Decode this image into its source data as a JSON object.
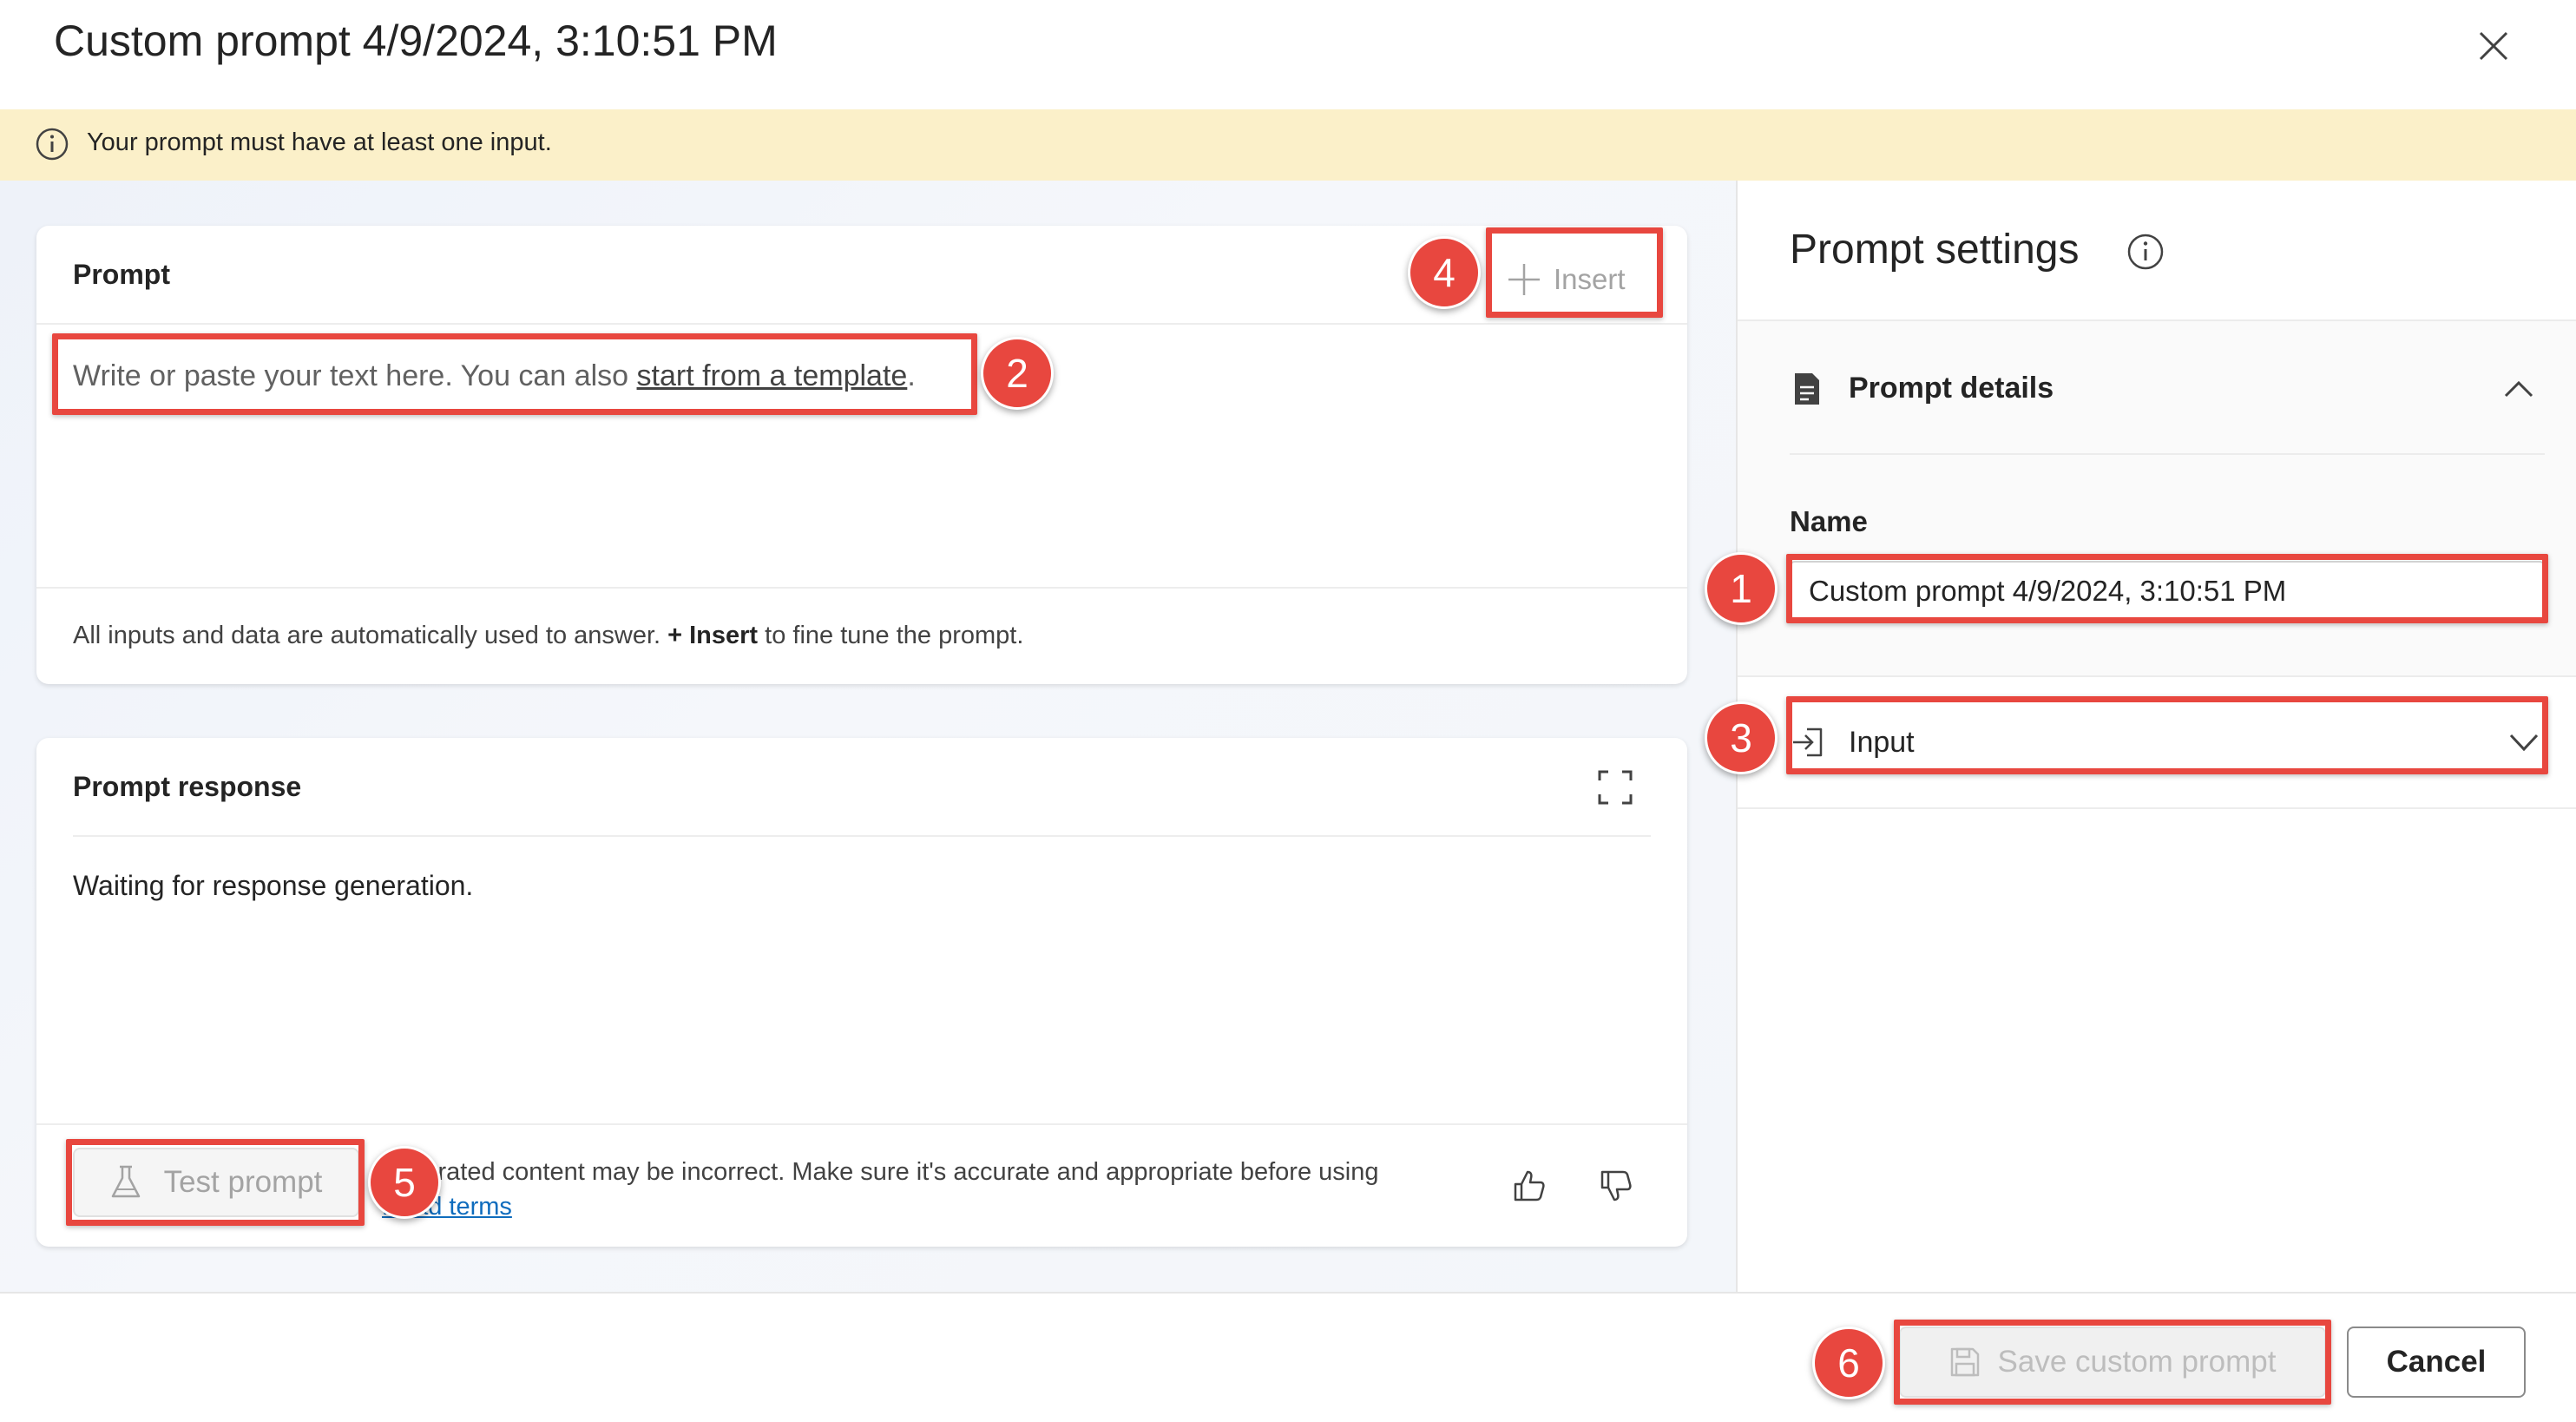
{
  "dialog": {
    "title": "Custom prompt 4/9/2024, 3:10:51 PM",
    "close_icon": "close-icon"
  },
  "banner": {
    "icon": "info-icon",
    "message": "Your prompt must have at least one input."
  },
  "prompt_card": {
    "title": "Prompt",
    "insert_label": "Insert",
    "placeholder_text": "Write or paste your text here. You can also ",
    "template_link": "start from a template",
    "placeholder_end": ".",
    "footer_prefix": "All inputs and data are automatically used to answer. ",
    "footer_bold": "+ Insert",
    "footer_suffix": " to fine tune the prompt."
  },
  "response_card": {
    "title": "Prompt response",
    "status_text": "Waiting for response generation.",
    "test_button_label": "Test prompt",
    "disclaimer": "generated content may be incorrect. Make sure it's accurate and appropriate before using",
    "read_terms_link": "Read terms"
  },
  "settings": {
    "title": "Prompt settings",
    "section_label": "Prompt details",
    "name_label": "Name",
    "name_value": "Custom prompt 4/9/2024, 3:10:51 PM",
    "input_label": "Input"
  },
  "footer": {
    "save_label": "Save custom prompt",
    "cancel_label": "Cancel"
  },
  "callouts": [
    "1",
    "2",
    "3",
    "4",
    "5",
    "6"
  ],
  "colors": {
    "banner_bg": "#fbf0c9",
    "callout_red": "#e8473f",
    "link_blue": "#0f6cbd"
  }
}
